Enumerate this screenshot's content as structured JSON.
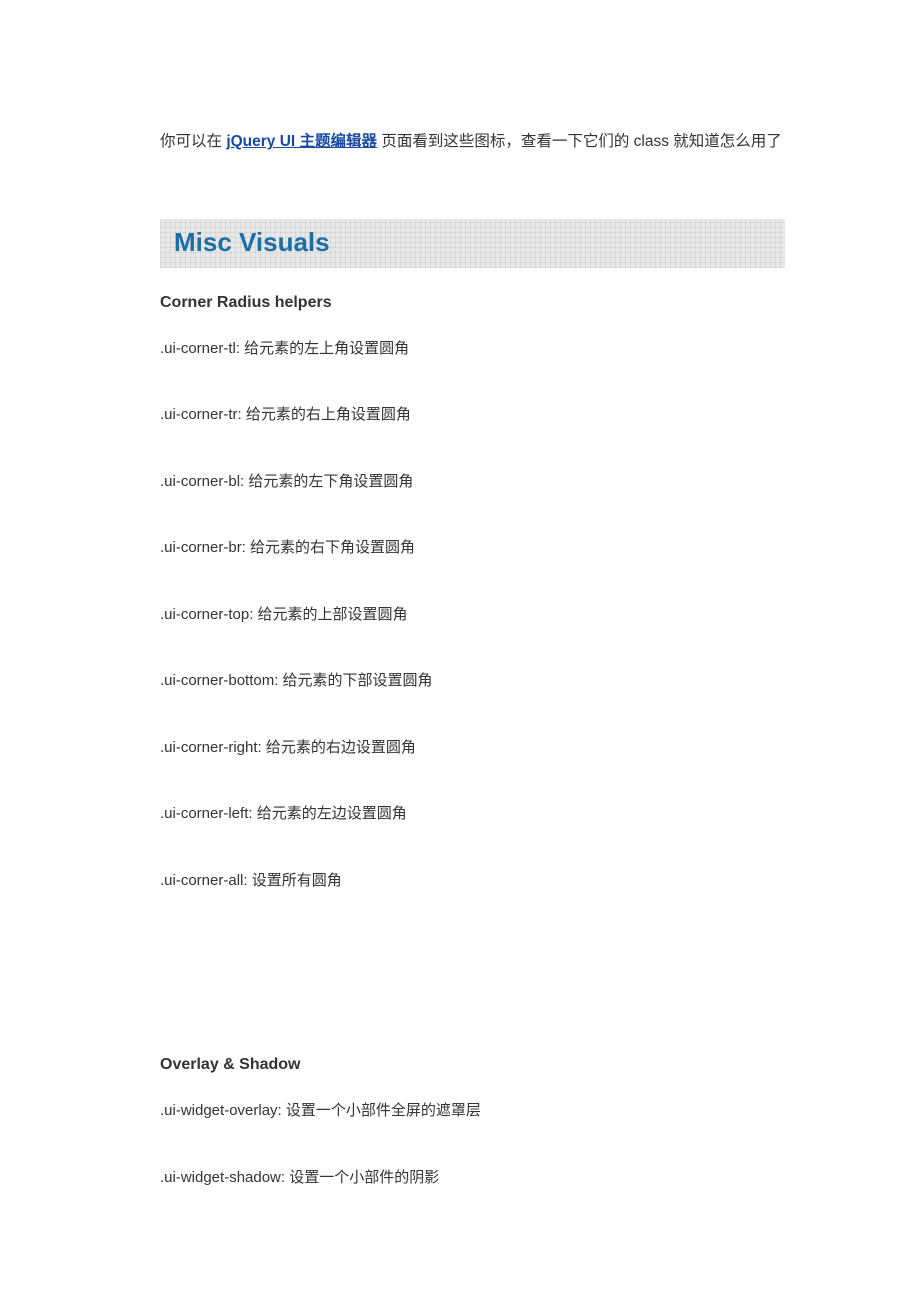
{
  "intro": {
    "prefix": "你可以在 ",
    "link_text": "jQuery UI  主题编辑器",
    "suffix": " 页面看到这些图标，查看一下它们的  class  就知道怎么用了"
  },
  "section_title": "Misc Visuals",
  "corner": {
    "title": "Corner Radius helpers",
    "items": [
      ".ui-corner-tl:  给元素的左上角设置圆角",
      ".ui-corner-tr:  给元素的右上角设置圆角",
      ".ui-corner-bl:  给元素的左下角设置圆角",
      ".ui-corner-br:  给元素的右下角设置圆角",
      ".ui-corner-top:  给元素的上部设置圆角",
      ".ui-corner-bottom:  给元素的下部设置圆角",
      ".ui-corner-right:  给元素的右边设置圆角",
      ".ui-corner-left:  给元素的左边设置圆角",
      ".ui-corner-all:  设置所有圆角"
    ]
  },
  "overlay": {
    "title": "Overlay & Shadow",
    "items": [
      ".ui-widget-overlay:  设置一个小部件全屏的遮罩层",
      ".ui-widget-shadow:  设置一个小部件的阴影"
    ]
  }
}
